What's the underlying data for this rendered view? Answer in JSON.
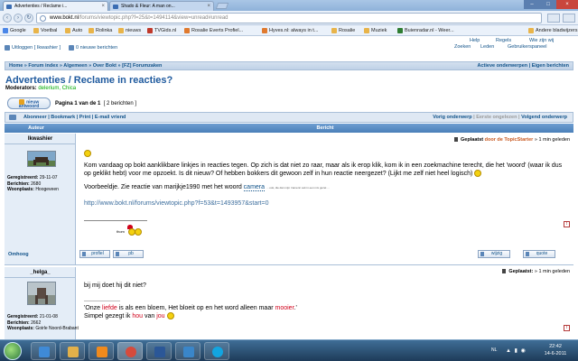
{
  "browser": {
    "tabs": [
      {
        "title": "Advertenties / Reclame i...",
        "active": true
      },
      {
        "title": "Shado & Fleur: A man on...",
        "active": false
      }
    ],
    "url_host": "www.bokt.nl",
    "url_path": "/forums/viewtopic.php?f=25&t=1494114&view=unread#unread",
    "bookmarks": [
      "Google",
      "Voetbal",
      "Auto",
      "Rolinka",
      "nieuws",
      "TVGids.nl",
      "Rosalie Everts Profiel...",
      "Hyves.nl: always in t...",
      "Rosalie",
      "Muziek",
      "Buienradar.nl - Weer...",
      "Andere bladwijzers"
    ]
  },
  "forum": {
    "logout": "Uitloggen [ Ikwashier ]",
    "new_messages": "0 nieuwe berichten",
    "help": "Help",
    "rules": "Regels",
    "whoisonline": "Wie zijn wij",
    "search": "Zoeken",
    "members": "Leden",
    "ucp": "Gebruikerspaneel",
    "breadcrumb": "Home » Forum index » Algemeen » Over Bokt » [FZ] Forumzaken",
    "breadcrumb_right": "Actieve onderwerpen | Eigen berichten",
    "topic_title": "Advertenties / Reclame in reacties?",
    "moderators_label": "Moderators:",
    "moderators": "delerium, Chica",
    "reply_button": "nieuw antwoord",
    "pagination_label": "Pagina 1 van de 1",
    "post_count": "[ 2 berichten ]",
    "tools_left": "Abonneer | Bookmark | Print | E-mail vriend",
    "tools_prev": "Vorig onderwerp",
    "tools_sep1": "|",
    "tools_first_unread": "Eerste ongelezen",
    "tools_sep2": "|",
    "tools_next": "Volgend onderwerp",
    "col_author": "Auteur",
    "col_message": "Bericht"
  },
  "posts": [
    {
      "author": "Ikwashier",
      "registered_label": "Geregistreerd:",
      "registered": "29-11-07",
      "posts_label": "Berichten:",
      "posts": "2680",
      "location_label": "Woonplaats:",
      "location": "Hoogeveen",
      "posted_label": "Geplaatst",
      "posted_by": "door de TopicStarter",
      "posted_when": "» 1 min geleden",
      "para1": "Kom vandaag op bokt aanklikbare linkjes in reacties tegen. Op zich is dat niet zo raar, maar als ik erop klik, kom ik in een zoekmachine terecht, die het 'woord' (waar ik dus op geklikt hebt) voor me opzoekt. Is dit nieuw? Of hebben bokkers dit gewoon zelf in hun reactie neergezet? (Lijkt me zelf niet heel logisch)",
      "para2_pre": "Voorbeeldje. Zie reactie van marijkje1990 met het woord",
      "para2_link": "camera",
      "para2_tiny": "... ook, die dan mijn 'camera' ook in een mix gezet ... ",
      "url_text": "http://www.bokt.nl/forums/viewtopic.php?f=53&t=1493957&start=0",
      "signature": "thom",
      "top_link": "Omhoog",
      "btn_profile": "profiel",
      "btn_pm": "pb",
      "btn_edit": "wijzig",
      "btn_quote": "quote"
    },
    {
      "author": "_helga_",
      "registered_label": "Geregistreerd:",
      "registered": "21-01-08",
      "posts_label": "Berichten:",
      "posts": "2662",
      "location_label": "Woonplaats:",
      "location": "Goirle Noord-Brabant",
      "posted_label": "Geplaatst:",
      "posted_when": "» 1 min geleden",
      "line1": "bij mij doet hij dit niet?",
      "quote_pre": "'Onze",
      "quote_w1": "liefde",
      "quote_mid": "is als een bloem, Het bloeit op en het word alleen maar",
      "quote_w2": "mooier",
      "quote_end": ".'",
      "line3_pre": "Simpel gezegt ik",
      "line3_w1": "hou",
      "line3_mid": "van",
      "line3_w2": "jou"
    }
  ],
  "taskbar": {
    "language": "NL",
    "time": "22:42",
    "date": "14-6-2011"
  },
  "colors": {
    "link": "#105289",
    "title": "#1f5a9e",
    "moderator": "#00aa00",
    "highlight_red": "#d0021b",
    "header_blue": "#4a7fb9"
  }
}
